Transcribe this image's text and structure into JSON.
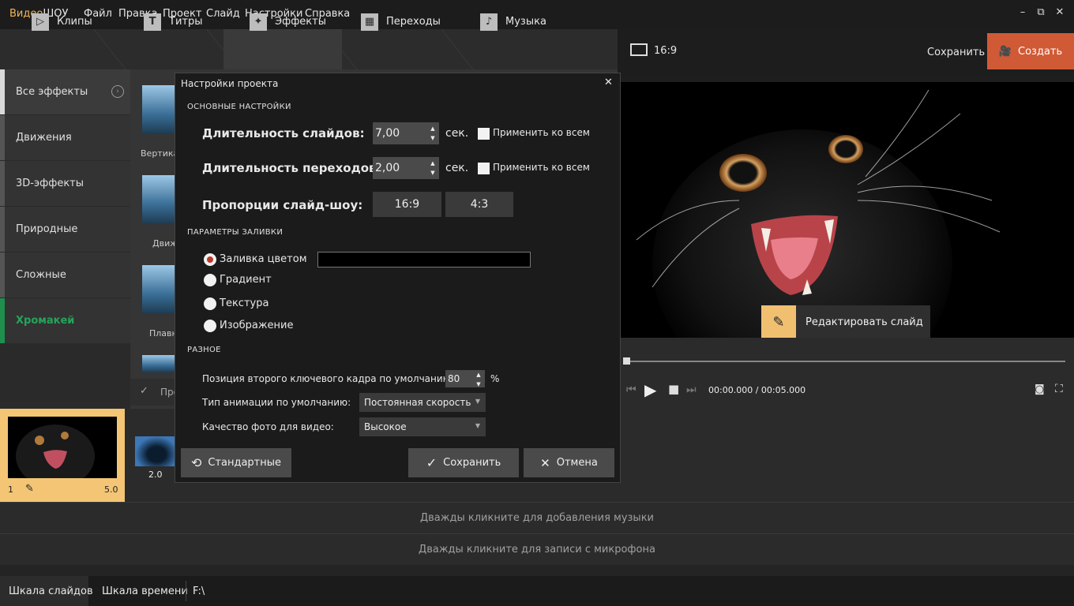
{
  "app": {
    "logo_part1": "Видео",
    "logo_part2": "ШОУ"
  },
  "menu": [
    "Файл",
    "Правка",
    "Проект",
    "Слайд",
    "Настройки",
    "Справка"
  ],
  "window_controls": [
    "–",
    "⧉",
    "✕"
  ],
  "tabs": [
    {
      "label": "Клипы",
      "icon": "play-icon"
    },
    {
      "label": "Титры",
      "icon": "text-icon"
    },
    {
      "label": "Эффекты",
      "icon": "magic-wand-icon"
    },
    {
      "label": "Переходы",
      "icon": "film-icon"
    },
    {
      "label": "Музыка",
      "icon": "music-icon"
    }
  ],
  "header_right": {
    "aspect": "16:9",
    "save": "Сохранить",
    "create": "Создать"
  },
  "sidebar": {
    "items": [
      "Все эффекты",
      "Движения",
      "3D-эффекты",
      "Природные",
      "Сложные",
      "Хромакей"
    ]
  },
  "grid_labels": [
    "Вертика",
    "Движ",
    "Плавн",
    "Про"
  ],
  "preview": {
    "edit_slide": "Редактировать слайд",
    "time_current": "00:00.000",
    "time_sep": " / ",
    "time_total": "00:05.000"
  },
  "storyboard": {
    "slide_number": "1",
    "slide_duration": "5.0",
    "transition_duration": "2.0"
  },
  "tracks": {
    "music": "Дважды кликните для добавления музыки",
    "mic": "Дважды кликните для записи с микрофона"
  },
  "bottom_tabs": {
    "slides": "Шкала слайдов",
    "timeline": "Шкала времени",
    "path": "F:\\"
  },
  "modal": {
    "title": "Настройки проекта",
    "close": "✕",
    "section_basic": "ОСНОВНЫЕ НАСТРОЙКИ",
    "slide_duration_label": "Длительность слайдов:",
    "slide_duration_value": "7,00",
    "transition_duration_label": "Длительность переходов:",
    "transition_duration_value": "2,00",
    "unit_sec": "сек.",
    "apply_all": "Применить ко всем",
    "aspect_label": "Пропорции слайд-шоу:",
    "aspect_options": [
      "16:9",
      "4:3"
    ],
    "section_fill": "ПАРАМЕТРЫ ЗАЛИВКИ",
    "fill_options": [
      "Заливка цветом",
      "Градиент",
      "Текстура",
      "Изображение"
    ],
    "fill_selected": "Заливка цветом",
    "fill_color": "#000000",
    "section_misc": "РАЗНОЕ",
    "keyframe_label": "Позиция второго ключевого кадра по умолчанию:",
    "keyframe_value": "80",
    "keyframe_unit": "%",
    "anim_label": "Тип анимации по умолчанию:",
    "anim_value": "Постоянная скорость",
    "quality_label": "Качество фото для видео:",
    "quality_value": "Высокое",
    "btn_default": "Стандартные",
    "btn_save": "Сохранить",
    "btn_cancel": "Отмена"
  },
  "colors": {
    "accent_orange": "#d05a36",
    "accent_yellow": "#f3c574",
    "green": "#27a35a"
  }
}
